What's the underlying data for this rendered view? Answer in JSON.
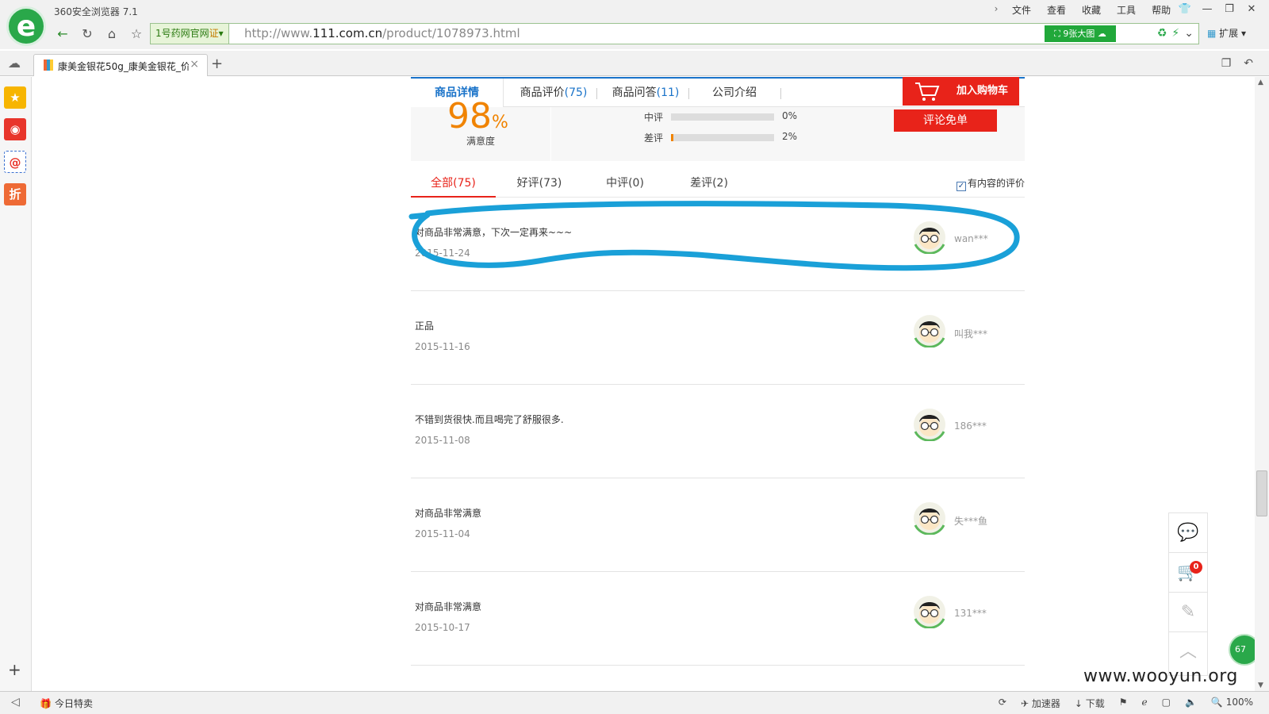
{
  "browser": {
    "app_title": "360安全浏览器 7.1",
    "menu": [
      "文件",
      "查看",
      "收藏",
      "工具",
      "帮助"
    ],
    "site_badge": "1号药网官网",
    "cert_badge": "证",
    "url_prefix": "http://www.",
    "url_host": "111.com.cn",
    "url_path": "/product/1078973.html",
    "big_image_btn": "9张大图",
    "extensions_label": "扩展",
    "tab_title": "康美金银花50g_康美金银花_价",
    "accent_color": "#2aa84a"
  },
  "sidebar": {
    "items": [
      "star-icon",
      "weibo-icon",
      "mail-icon",
      "discount-icon"
    ],
    "discount_label": "折"
  },
  "statusbar": {
    "today_deal": "今日特卖",
    "accelerator": "加速器",
    "download": "下载",
    "zoom": "100%"
  },
  "product_tabs": {
    "details": "商品详情",
    "reviews_label": "商品评价",
    "reviews_count": "(75)",
    "qa_label": "商品问答",
    "qa_count": "(11)",
    "company": "公司介绍",
    "add_to_cart": "加入购物车"
  },
  "summary": {
    "satisfaction_value": "98",
    "satisfaction_sign": "%",
    "satisfaction_label": "满意度",
    "rows": [
      {
        "label": "中评",
        "percent": 0,
        "value": "0%"
      },
      {
        "label": "差评",
        "percent": 2,
        "value": "2%"
      }
    ],
    "review_free_btn": "评论免单"
  },
  "filters": {
    "all": "全部(75)",
    "good": "好评(73)",
    "medium": "中评(0)",
    "bad": "差评(2)",
    "with_content": "有内容的评价",
    "with_content_checked": true
  },
  "reviews": [
    {
      "text": "对商品非常满意，下次一定再来~~~",
      "date": "2015-11-24",
      "user": "wan***"
    },
    {
      "text": "正品",
      "date": "2015-11-16",
      "user": "叫我***"
    },
    {
      "text": "不错到货很快.而且喝完了舒服很多.",
      "date": "2015-11-08",
      "user": "186***"
    },
    {
      "text": "对商品非常满意",
      "date": "2015-11-04",
      "user": "失***鱼"
    },
    {
      "text": "对商品非常满意",
      "date": "2015-10-17",
      "user": "131***"
    }
  ],
  "float_bar": {
    "cart_count": "0",
    "green_badge": "67"
  },
  "annotation": {
    "highlight_color": "#1aa0d8"
  },
  "watermark": "www.wooyun.org"
}
